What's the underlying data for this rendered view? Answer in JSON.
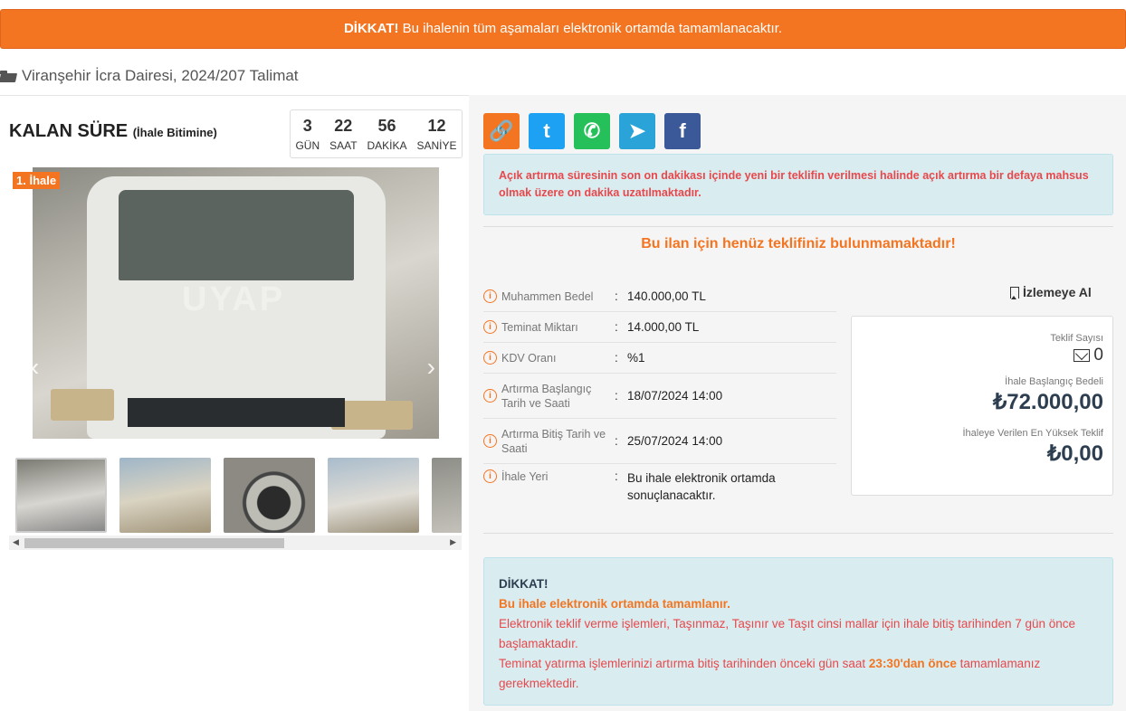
{
  "banner": {
    "strong": "DİKKAT!",
    "text": " Bu ihalenin tüm aşamaları elektronik ortamda tamamlanacaktır."
  },
  "breadcrumb": {
    "text": "Viranşehir İcra Dairesi, 2024/207 Talimat"
  },
  "timer": {
    "title": "KALAN SÜRE",
    "subtitle": "(İhale Bitimine)",
    "units": [
      {
        "value": "3",
        "label": "GÜN"
      },
      {
        "value": "22",
        "label": "SAAT"
      },
      {
        "value": "56",
        "label": "DAKİKA"
      },
      {
        "value": "12",
        "label": "SANİYE"
      }
    ]
  },
  "gallery": {
    "badge": "1. İhale",
    "watermark": "UYAP",
    "prev": "‹",
    "next": "›"
  },
  "share": {
    "link": "🔗",
    "twitter": "t",
    "whatsapp": "✆",
    "telegram": "➤",
    "facebook": "f"
  },
  "alert1": {
    "text": "Açık artırma süresinin son on dakikası içinde yeni bir teklifin verilmesi halinde açık artırma bir defaya mahsus olmak üzere on dakika uzatılmaktadır."
  },
  "no_offer": "Bu ilan için henüz teklifiniz bulunmamaktadır!",
  "info": [
    {
      "label": "Muhammen Bedel",
      "value": "140.000,00 TL"
    },
    {
      "label": "Teminat Miktarı",
      "value": "14.000,00 TL"
    },
    {
      "label": "KDV Oranı",
      "value": "%1"
    },
    {
      "label": "Artırma Başlangıç Tarih ve Saati",
      "value": "18/07/2024 14:00"
    },
    {
      "label": "Artırma Bitiş Tarih ve Saati",
      "value": "25/07/2024 14:00"
    },
    {
      "label": "İhale Yeri",
      "value": "Bu ihale elektronik ortamda sonuçlanacaktır."
    }
  ],
  "info_separator": ":",
  "info_icon": "i",
  "watch": "İzlemeye Al",
  "card": {
    "teklif_label": "Teklif Sayısı",
    "teklif_count": "0",
    "start_label": "İhale Başlangıç Bedeli",
    "start_value": "₺72.000,00",
    "highest_label": "İhaleye Verilen En Yüksek Teklif",
    "highest_value": "₺0,00"
  },
  "alert2": {
    "title": "DİKKAT!",
    "subtitle": "Bu ihale elektronik ortamda tamamlanır.",
    "line1": "Elektronik teklif verme işlemleri, Taşınmaz, Taşınır ve Taşıt cinsi mallar için ihale bitiş tarihinden 7 gün önce başlamaktadır.",
    "line2_a": "Teminat yatırma işlemlerinizi artırma bitiş tarihinden önceki gün saat ",
    "line2_em": "23:30'dan önce",
    "line2_b": " tamamlamanız gerekmektedir."
  },
  "colors": {
    "accent": "#f47521",
    "info_bg": "#d9edf1",
    "danger": "#e8484b"
  }
}
